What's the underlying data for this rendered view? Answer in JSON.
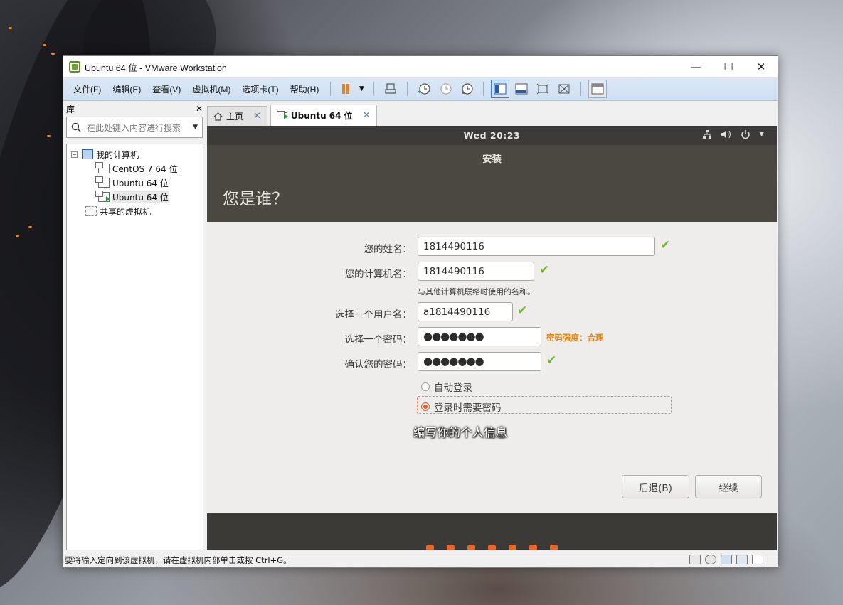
{
  "window": {
    "title": "Ubuntu 64 位 - VMware Workstation",
    "minimize": "—",
    "maximize": "☐",
    "close": "✕"
  },
  "menu": [
    "文件(F)",
    "编辑(E)",
    "查看(V)",
    "虚拟机(M)",
    "选项卡(T)",
    "帮助(H)"
  ],
  "library": {
    "title": "库",
    "close": "✕",
    "search_placeholder": "在此处键入内容进行搜索",
    "tree": {
      "root": "我的计算机",
      "vms": [
        "CentOS 7 64 位",
        "Ubuntu 64 位",
        "Ubuntu 64 位"
      ],
      "shared": "共享的虚拟机"
    }
  },
  "tabs": [
    {
      "label": "主页",
      "close": "✕"
    },
    {
      "label": "Ubuntu 64 位",
      "close": "✕"
    }
  ],
  "guest": {
    "clock": "Wed 20:23",
    "installer_title": "安装",
    "page_title": "您是谁？",
    "fields": {
      "name_label": "您的姓名：",
      "name_value": "1814490116",
      "computer_label": "您的计算机名：",
      "computer_value": "1814490116",
      "computer_hint": "与其他计算机联络时使用的名称。",
      "username_label": "选择一个用户名：",
      "username_value": "a1814490116",
      "password_label": "选择一个密码：",
      "password_value": "●●●●●●●",
      "password_strength": "密码强度：合理",
      "confirm_label": "确认您的密码：",
      "confirm_value": "●●●●●●●"
    },
    "options": {
      "auto_login": "自动登录",
      "require_password": "登录时需要密码"
    },
    "subtitle": "编写你的个人信息",
    "buttons": {
      "back": "后退(B)",
      "continue": "继续"
    },
    "check": "✔",
    "colors": {
      "accent": "#e95420",
      "check": "#73b52b",
      "strength": "#e28a19"
    }
  },
  "status": {
    "message": "要将输入定向到该虚拟机，请在虚拟机内部单击或按 Ctrl+G。"
  }
}
